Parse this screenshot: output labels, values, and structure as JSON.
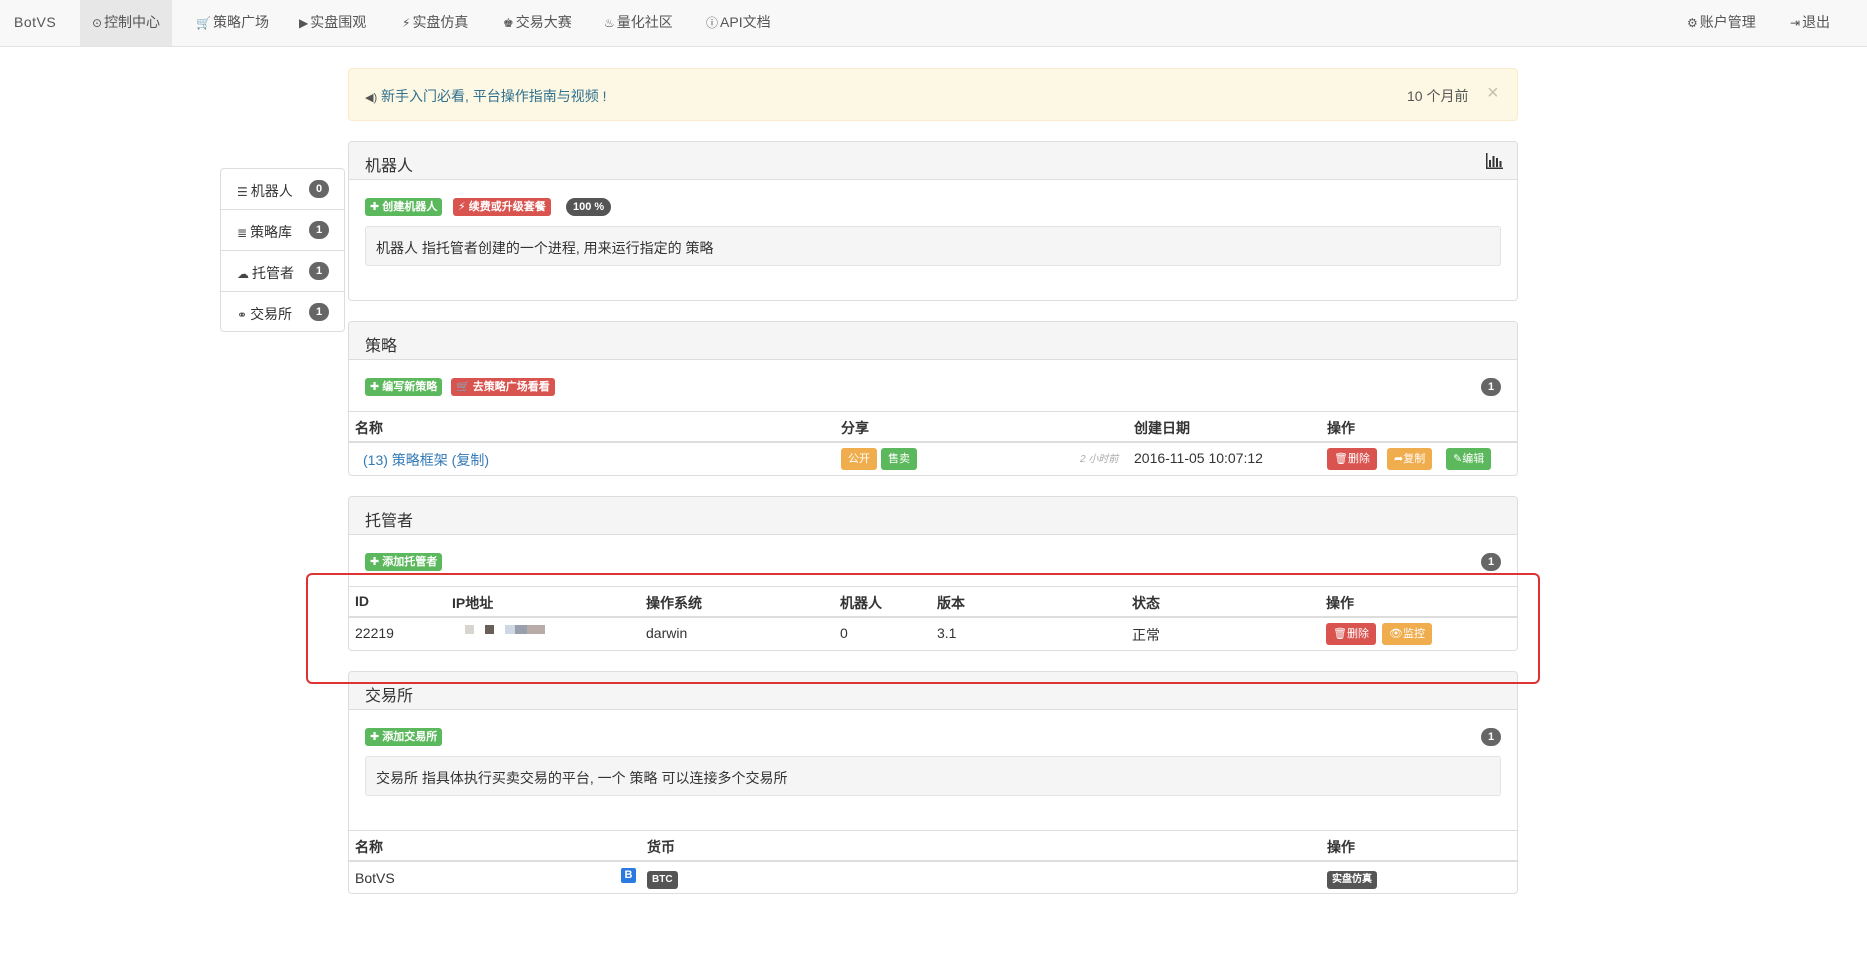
{
  "navbar": {
    "brand": "BotVS",
    "items": [
      {
        "icon": "clock-icon",
        "glyph": "⊙",
        "label": "控制中心"
      },
      {
        "icon": "cart-icon",
        "glyph": "🛒",
        "label": "策略广场"
      },
      {
        "icon": "play-icon",
        "glyph": "▶",
        "label": "实盘围观"
      },
      {
        "icon": "bolt-icon",
        "glyph": "⚡",
        "label": "实盘仿真"
      },
      {
        "icon": "trophy-icon",
        "glyph": "♚",
        "label": "交易大赛"
      },
      {
        "icon": "fire-icon",
        "glyph": "♨",
        "label": "量化社区"
      },
      {
        "icon": "info-icon",
        "glyph": "ⓘ",
        "label": "API文档"
      }
    ],
    "right_items": [
      {
        "icon": "gear-icon",
        "glyph": "⚙",
        "label": "账户管理"
      },
      {
        "icon": "logout-icon",
        "glyph": "⇥",
        "label": "退出"
      }
    ]
  },
  "alert": {
    "text": "新手入门必看, 平台操作指南与视频 !",
    "time": "10 个月前",
    "close": "×"
  },
  "sidebar": {
    "items": [
      {
        "icon": "server-icon",
        "glyph": "☰",
        "label": "机器人",
        "count": "0"
      },
      {
        "icon": "database-icon",
        "glyph": "≣",
        "label": "策略库",
        "count": "1"
      },
      {
        "icon": "cloud-icon",
        "glyph": "☁",
        "label": "托管者",
        "count": "1"
      },
      {
        "icon": "cubes-icon",
        "glyph": "⚭",
        "label": "交易所",
        "count": "1"
      }
    ]
  },
  "robots": {
    "title": "机器人",
    "btn_create": "✚ 创建机器人",
    "btn_renew": "⚡ 续费或升级套餐",
    "percent": "100 %",
    "desc": "机器人 指托管者创建的一个进程, 用来运行指定的 策略"
  },
  "strategy": {
    "title": "策略",
    "btn_new": "✚ 编写新策略",
    "btn_market": "🛒 去策略广场看看",
    "count": "1",
    "headers": [
      "名称",
      "分享",
      "创建日期",
      "操作"
    ],
    "rows": [
      {
        "name": "(13) 策略框架 (复制)",
        "share_public": "公开",
        "share_sell": "售卖",
        "ago": "2 小时前",
        "created": "2016-11-05 10:07:12",
        "btn_delete": "🗑删除",
        "btn_copy": "➦复制",
        "btn_edit": "✎编辑"
      }
    ]
  },
  "hosts": {
    "title": "托管者",
    "btn_add": "✚ 添加托管者",
    "count": "1",
    "headers": [
      "ID",
      "IP地址",
      "操作系统",
      "机器人",
      "版本",
      "状态",
      "操作"
    ],
    "rows": [
      {
        "id": "22219",
        "os": "darwin",
        "robots": "0",
        "version": "3.1",
        "status": "正常",
        "btn_delete": "🗑删除",
        "btn_monitor": "👁监控"
      }
    ]
  },
  "exchanges": {
    "title": "交易所",
    "btn_add": "✚ 添加交易所",
    "count": "1",
    "desc": "交易所 指具体执行买卖交易的平台, 一个 策略 可以连接多个交易所",
    "headers": [
      "名称",
      "货币",
      "操作"
    ],
    "rows": [
      {
        "name": "BotVS",
        "icon_letter": "B",
        "currency": "BTC",
        "action": "实盘仿真"
      }
    ]
  }
}
